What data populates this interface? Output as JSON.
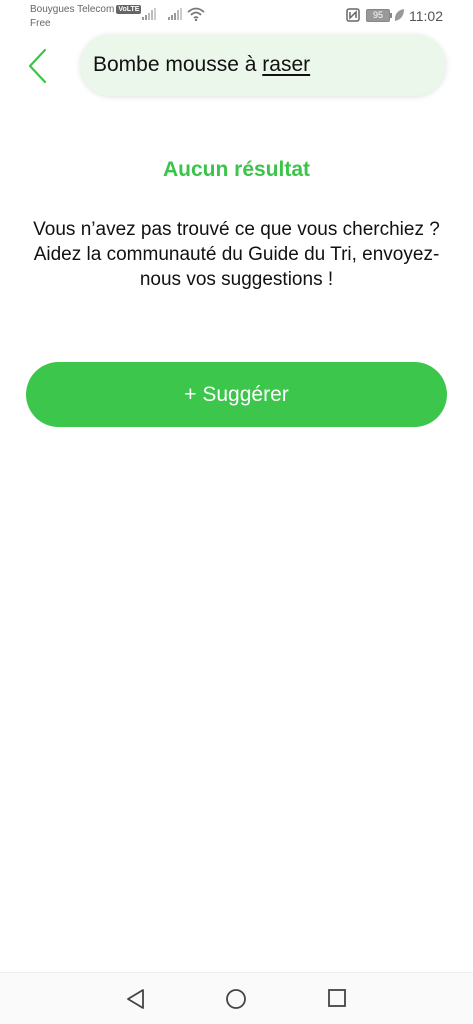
{
  "status_bar": {
    "carrier_primary": "Bouygues Telecom",
    "volte_badge": "VoLTE",
    "carrier_secondary": "Free",
    "battery_level": "95",
    "time": "11:02"
  },
  "search": {
    "query_prefix": "Bombe mousse à ",
    "query_underlined": "raser"
  },
  "empty_state": {
    "title": "Aucun résultat",
    "message": "Vous n’avez pas trouvé ce que vous cherchiez ? Aidez la communauté du Guide du Tri, envoyez-nous vos suggestions !",
    "suggest_button_label": "+ Suggérer"
  },
  "icons": {
    "back": "chevron-left-icon",
    "nav_back": "triangle-back-icon",
    "nav_home": "circle-home-icon",
    "nav_recent": "square-recent-icon"
  },
  "colors": {
    "accent": "#3cc44a",
    "search_bg": "#eaf7ea"
  }
}
